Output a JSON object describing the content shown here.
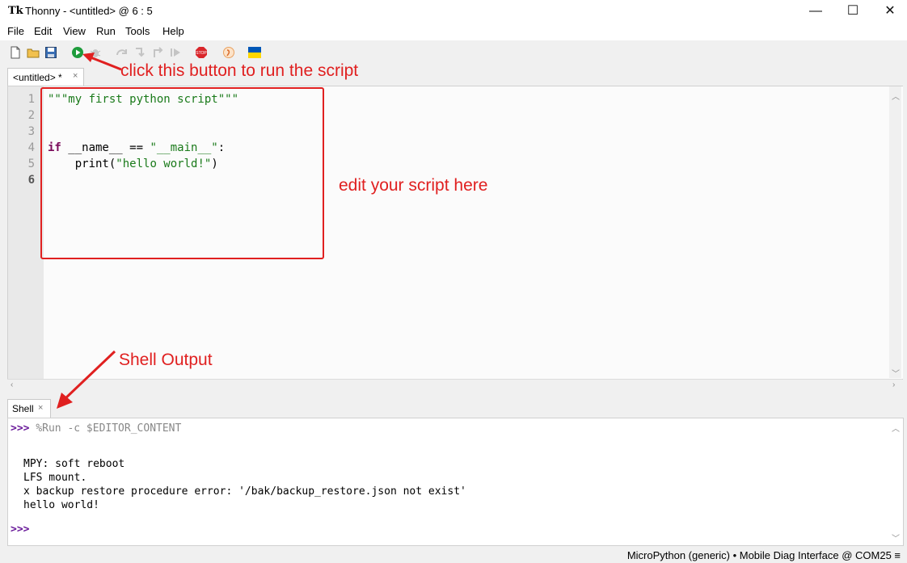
{
  "window": {
    "app_icon": "Tk",
    "title": "Thonny  -  <untitled>  @  6 : 5",
    "minimize_icon": "minimize-icon",
    "maximize_icon": "maximize-icon",
    "close_icon": "close-icon"
  },
  "menu": [
    "File",
    "Edit",
    "View",
    "Run",
    "Tools",
    "Help"
  ],
  "toolbar": {
    "icons": [
      "new-file-icon",
      "open-file-icon",
      "save-icon",
      "run-icon",
      "debug-icon",
      "step-over-icon",
      "step-into-icon",
      "step-out-icon",
      "resume-icon",
      "stop-icon",
      "support-icon",
      "ukraine-flag-icon"
    ],
    "colors": {
      "run": "#1e9c3c",
      "stop": "#d9262b",
      "flag_blue": "#0057b7",
      "flag_yellow": "#ffd700"
    }
  },
  "editor": {
    "tab_label": "<untitled> *",
    "tab_close": "×",
    "line_numbers": [
      "1",
      "2",
      "3",
      "4",
      "5",
      "6"
    ],
    "line1": "\"\"\"my first python script\"\"\"",
    "line4_kw": "if",
    "line4_mid": " __name__ == ",
    "line4_str": "\"__main__\"",
    "line4_end": ":",
    "line5_pre": "    print(",
    "line5_str": "\"hello world!\"",
    "line5_end": ")"
  },
  "shell": {
    "tab_label": "Shell",
    "tab_close": "×",
    "prompt": ">>>",
    "command": "%Run -c $EDITOR_CONTENT",
    "output": [
      "MPY: soft reboot",
      "LFS mount.",
      "x backup restore procedure error: '/bak/backup_restore.json not exist'",
      "hello world!"
    ],
    "prompt2": ">>>"
  },
  "status": {
    "text": "MicroPython (generic)  •  Mobile Diag Interface @ COM25  ≡"
  },
  "annotations": {
    "run_hint": "click this button to run the script",
    "edit_hint": "edit your script here",
    "shell_hint": "Shell Output",
    "color": "#e02020"
  }
}
